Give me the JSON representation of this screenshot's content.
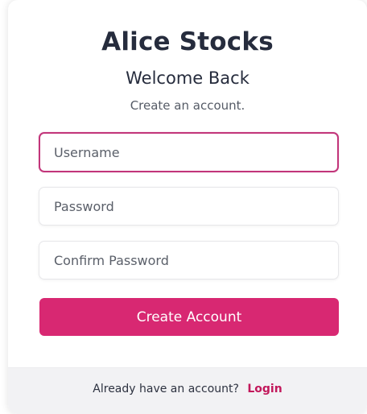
{
  "header": {
    "brand": "Alice Stocks",
    "welcome": "Welcome Back",
    "subtitle": "Create an account."
  },
  "form": {
    "username": {
      "placeholder": "Username",
      "value": ""
    },
    "password": {
      "placeholder": "Password",
      "value": ""
    },
    "confirm_password": {
      "placeholder": "Confirm Password",
      "value": ""
    },
    "submit_label": "Create Account"
  },
  "footer": {
    "prompt": "Already have an account?",
    "login_label": "Login"
  },
  "colors": {
    "accent": "#d82872",
    "link": "#c2185b",
    "focus_border": "#c2357a",
    "heading": "#262c3d"
  }
}
